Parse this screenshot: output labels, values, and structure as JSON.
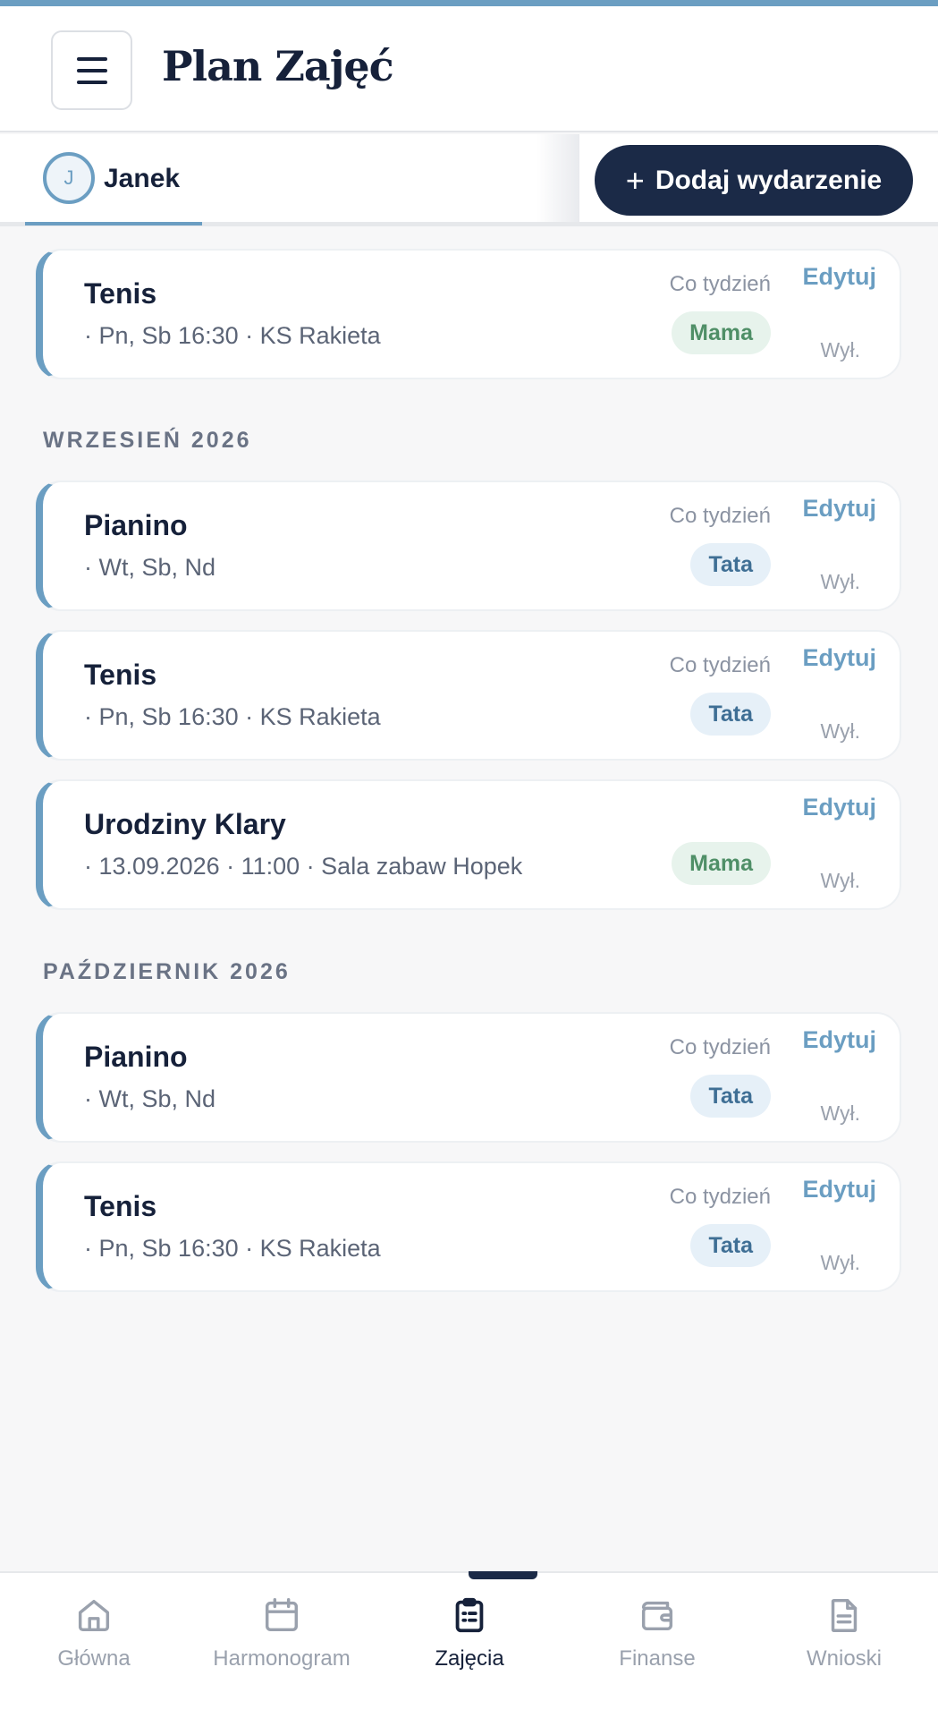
{
  "header": {
    "title": "Plan Zajęć"
  },
  "child": {
    "initial": "J",
    "name": "Janek"
  },
  "actions": {
    "add_label": "Dodaj wydarzenie"
  },
  "labels": {
    "edit": "Edytuj",
    "off": "Wył."
  },
  "colors": {
    "accent": "#6b9ec2",
    "navy": "#1b2a47",
    "mama_bg": "#e7f3ec",
    "tata_bg": "#e6f0f8"
  },
  "events": [
    {
      "title": "Tenis",
      "meta": "· Pn, Sb 16:30  · KS Rakieta",
      "freq": "Co tydzień",
      "who": "Mama"
    },
    {
      "title": "Pianino",
      "meta": "· Wt, Sb, Nd",
      "freq": "Co tydzień",
      "who": "Tata"
    },
    {
      "title": "Tenis",
      "meta": "· Pn, Sb 16:30  · KS Rakieta",
      "freq": "Co tydzień",
      "who": "Tata"
    },
    {
      "title": "Urodziny Klary",
      "meta": "· 13.09.2026  · 11:00  · Sala zabaw Hopek",
      "freq": "",
      "who": "Mama"
    },
    {
      "title": "Pianino",
      "meta": "· Wt, Sb, Nd",
      "freq": "Co tydzień",
      "who": "Tata"
    },
    {
      "title": "Tenis",
      "meta": "· Pn, Sb 16:30  · KS Rakieta",
      "freq": "Co tydzień",
      "who": "Tata"
    }
  ],
  "months": [
    "WRZESIEŃ 2026",
    "PAŹDZIERNIK 2026"
  ],
  "nav": [
    {
      "label": "Główna",
      "icon": "home-icon"
    },
    {
      "label": "Harmonogram",
      "icon": "calendar-icon"
    },
    {
      "label": "Zajęcia",
      "icon": "clipboard-icon",
      "active": true
    },
    {
      "label": "Finanse",
      "icon": "wallet-icon"
    },
    {
      "label": "Wnioski",
      "icon": "document-icon"
    }
  ]
}
